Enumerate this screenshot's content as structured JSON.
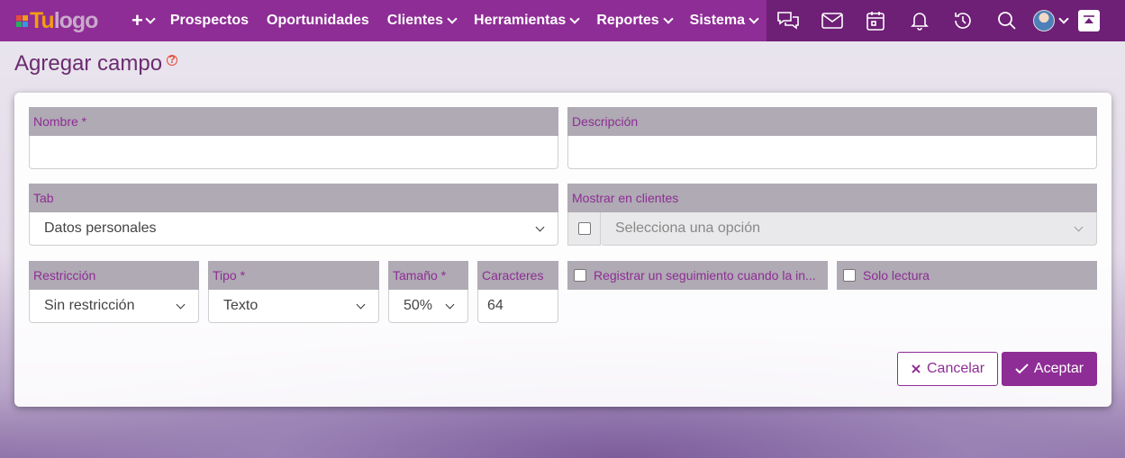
{
  "brand": {
    "logo_prefix": "Tu",
    "logo_rest": "logo",
    "colors": {
      "primary": "#8e2d95",
      "dark": "#6e1f76",
      "accent": "#f39c12",
      "label_bg": "#afaab3"
    }
  },
  "navbar": {
    "plus_label": "+",
    "items": [
      {
        "label": "Prospectos",
        "dropdown": false
      },
      {
        "label": "Oportunidades",
        "dropdown": false
      },
      {
        "label": "Clientes",
        "dropdown": true
      },
      {
        "label": "Herramientas",
        "dropdown": true
      },
      {
        "label": "Reportes",
        "dropdown": true
      },
      {
        "label": "Sistema",
        "dropdown": true
      }
    ],
    "right_icons": [
      "chat-icon",
      "mail-icon",
      "calendar-icon",
      "bell-icon",
      "history-icon",
      "search-icon",
      "avatar",
      "scroll-top-icon"
    ]
  },
  "page": {
    "title": "Agregar campo",
    "help": "?"
  },
  "form": {
    "nombre": {
      "label": "Nombre *",
      "value": ""
    },
    "descripcion": {
      "label": "Descripción",
      "value": ""
    },
    "tab": {
      "label": "Tab",
      "value": "Datos personales"
    },
    "mostrar": {
      "label": "Mostrar en clientes",
      "placeholder": "Selecciona una opción",
      "checked": false
    },
    "restriccion": {
      "label": "Restricción",
      "value": "Sin restricción"
    },
    "tipo": {
      "label": "Tipo *",
      "value": "Texto"
    },
    "tamano": {
      "label": "Tamaño *",
      "value": "50%"
    },
    "caracteres": {
      "label": "Caracteres",
      "value": "64"
    },
    "seguimiento": {
      "label": "Registrar un seguimiento cuando la in...",
      "checked": false
    },
    "solo_lectura": {
      "label": "Solo lectura",
      "checked": false
    }
  },
  "actions": {
    "cancel_label": "Cancelar",
    "accept_label": "Aceptar"
  }
}
